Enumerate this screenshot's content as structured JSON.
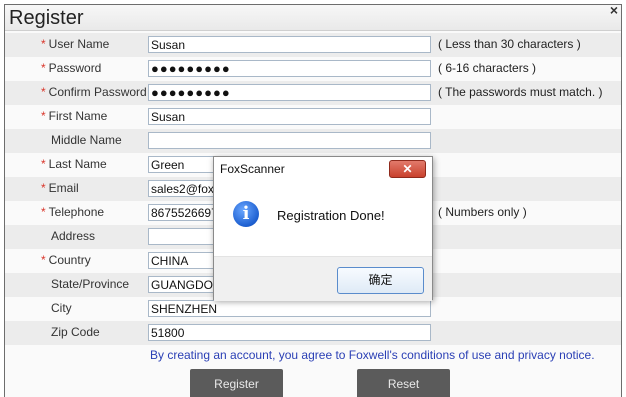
{
  "window": {
    "title": "Register",
    "close_glyph": "×"
  },
  "form": {
    "rows": [
      {
        "label": "User Name",
        "required": true,
        "value": "Susan",
        "hint": "( Less than 30 characters )"
      },
      {
        "label": "Password",
        "required": true,
        "value": "●●●●●●●●●",
        "hint": "( 6-16 characters )"
      },
      {
        "label": "Confirm Password",
        "required": true,
        "value": "●●●●●●●●●",
        "hint": "( The passwords must match. )"
      },
      {
        "label": "First Name",
        "required": true,
        "value": "Susan",
        "hint": ""
      },
      {
        "label": "Middle Name",
        "required": false,
        "value": "",
        "hint": ""
      },
      {
        "label": "Last Name",
        "required": true,
        "value": "Green",
        "hint": ""
      },
      {
        "label": "Email",
        "required": true,
        "value": "sales2@foxw",
        "hint": ""
      },
      {
        "label": "Telephone",
        "required": true,
        "value": "86755266972",
        "hint": "( Numbers only )"
      },
      {
        "label": "Address",
        "required": false,
        "value": "",
        "hint": ""
      },
      {
        "label": "Country",
        "required": true,
        "value": "CHINA",
        "hint": ""
      },
      {
        "label": "State/Province",
        "required": false,
        "value": "GUANGDONG",
        "hint": ""
      },
      {
        "label": "City",
        "required": false,
        "value": "SHENZHEN",
        "hint": ""
      },
      {
        "label": "Zip Code",
        "required": false,
        "value": "51800",
        "hint": ""
      }
    ],
    "required_mark": "*",
    "agreement": "By creating an account, you agree to Foxwell's conditions of use and privacy notice.",
    "register_label": "Register",
    "reset_label": "Reset"
  },
  "dialog": {
    "title": "FoxScanner",
    "close_glyph": "✕",
    "icon": "info-icon",
    "icon_glyph": "i",
    "message": "Registration Done!",
    "ok_label": "确定"
  },
  "colors": {
    "required": "#d9362b",
    "agreement_text": "#2a3fb5",
    "button_bg": "#5b5b5b",
    "dialog_close": "#c9412d"
  }
}
